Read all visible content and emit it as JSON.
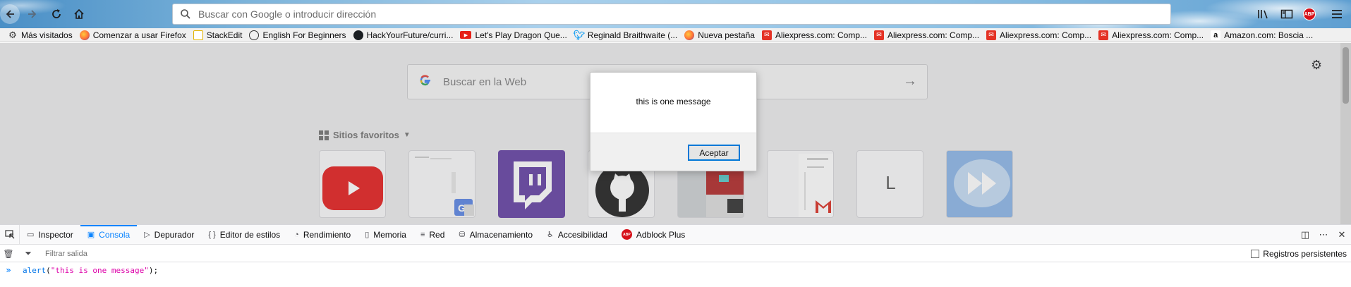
{
  "toolbar": {
    "url_placeholder": "Buscar con Google o introducir dirección"
  },
  "bookmarks": [
    {
      "label": "Más visitados",
      "icon": "gear-icon"
    },
    {
      "label": "Comenzar a usar Firefox",
      "icon": "firefox-icon"
    },
    {
      "label": "StackEdit",
      "icon": "stackedit-icon"
    },
    {
      "label": "English For Beginners",
      "icon": "globe-icon"
    },
    {
      "label": "HackYourFuture/curri...",
      "icon": "github-icon"
    },
    {
      "label": "Let's Play Dragon Que...",
      "icon": "youtube-icon"
    },
    {
      "label": "Reginald Braithwaite (...",
      "icon": "twitter-icon"
    },
    {
      "label": "Nueva pestaña",
      "icon": "firefox-icon"
    },
    {
      "label": "Aliexpress.com: Comp...",
      "icon": "aliexpress-icon"
    },
    {
      "label": "Aliexpress.com: Comp...",
      "icon": "aliexpress-icon"
    },
    {
      "label": "Aliexpress.com: Comp...",
      "icon": "aliexpress-icon"
    },
    {
      "label": "Aliexpress.com: Comp...",
      "icon": "aliexpress-icon"
    },
    {
      "label": "Amazon.com: Boscia ...",
      "icon": "amazon-icon"
    }
  ],
  "newtab": {
    "search_placeholder": "Buscar en la Web",
    "topsites_label": "Sitios favoritos",
    "tile_letter": "L"
  },
  "dialog": {
    "message": "this is one message",
    "ok_label": "Aceptar"
  },
  "devtools": {
    "tabs": [
      {
        "label": "Inspector",
        "icon": "inspector-icon"
      },
      {
        "label": "Consola",
        "icon": "console-icon",
        "active": true
      },
      {
        "label": "Depurador",
        "icon": "debugger-icon"
      },
      {
        "label": "Editor de estilos",
        "icon": "style-editor-icon"
      },
      {
        "label": "Rendimiento",
        "icon": "performance-icon"
      },
      {
        "label": "Memoria",
        "icon": "memory-icon"
      },
      {
        "label": "Red",
        "icon": "network-icon"
      },
      {
        "label": "Almacenamiento",
        "icon": "storage-icon"
      },
      {
        "label": "Accesibilidad",
        "icon": "accessibility-icon"
      },
      {
        "label": "Adblock Plus",
        "icon": "abp-icon"
      }
    ],
    "filter_placeholder": "Filtrar salida",
    "persist_label": "Registros persistentes",
    "console_input": {
      "fn": "alert",
      "open": "(",
      "arg": "\"this is one message\"",
      "close": ");"
    }
  },
  "colors": {
    "accent": "#0a84ff",
    "abp_red": "#d6111a",
    "twitch": "#6441a4",
    "youtube": "#e41f1f"
  }
}
